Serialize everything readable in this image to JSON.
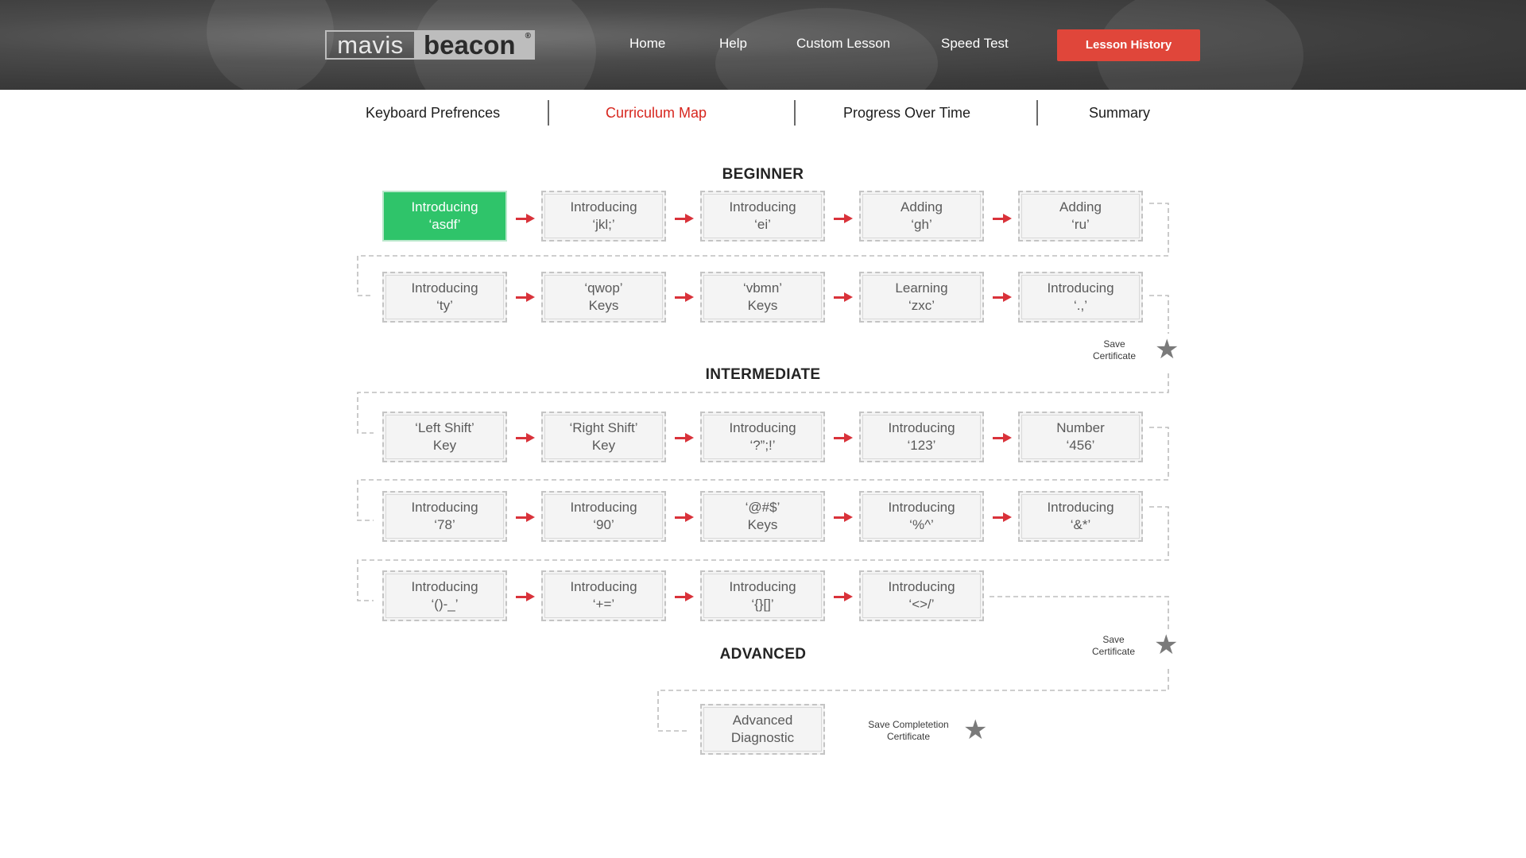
{
  "header": {
    "logo": {
      "left": "mavis",
      "right": "beacon",
      "mark": "®"
    },
    "nav": [
      "Home",
      "Help",
      "Custom Lesson",
      "Speed Test"
    ],
    "cta": "Lesson History",
    "cta_color": "#e0463a"
  },
  "tabs": [
    {
      "label": "Keyboard Prefrences",
      "active": false
    },
    {
      "label": "Curriculum Map",
      "active": true
    },
    {
      "label": "Progress Over Time",
      "active": false
    },
    {
      "label": "Summary",
      "active": false
    }
  ],
  "accent_color": "#d7261e",
  "sections": {
    "beginner": "BEGINNER",
    "intermediate": "INTERMEDIATE",
    "advanced": "ADVANCED"
  },
  "lessons": {
    "beginner_row1": [
      {
        "line1": "Introducing",
        "line2": "‘asdf’",
        "active": true
      },
      {
        "line1": "Introducing",
        "line2": "‘jkl;’"
      },
      {
        "line1": "Introducing",
        "line2": "‘ei’"
      },
      {
        "line1": "Adding",
        "line2": "‘gh’"
      },
      {
        "line1": "Adding",
        "line2": "‘ru’"
      }
    ],
    "beginner_row2": [
      {
        "line1": "Introducing",
        "line2": "‘ty’"
      },
      {
        "line1": "‘qwop’",
        "line2": "Keys"
      },
      {
        "line1": "‘vbmn’",
        "line2": "Keys"
      },
      {
        "line1": "Learning",
        "line2": "‘zxc’"
      },
      {
        "line1": "Introducing",
        "line2": "‘.,’"
      }
    ],
    "intermediate_row1": [
      {
        "line1": "‘Left Shift’",
        "line2": "Key"
      },
      {
        "line1": "‘Right Shift’",
        "line2": "Key"
      },
      {
        "line1": "Introducing",
        "line2": "‘?”;!’"
      },
      {
        "line1": "Introducing",
        "line2": "‘123’"
      },
      {
        "line1": "Number",
        "line2": "‘456’"
      }
    ],
    "intermediate_row2": [
      {
        "line1": "Introducing",
        "line2": "‘78’"
      },
      {
        "line1": "Introducing",
        "line2": "‘90’"
      },
      {
        "line1": "‘@#$’",
        "line2": "Keys"
      },
      {
        "line1": "Introducing",
        "line2": "‘%^’"
      },
      {
        "line1": "Introducing",
        "line2": "‘&*’"
      }
    ],
    "intermediate_row3": [
      {
        "line1": "Introducing",
        "line2": "‘()-_’"
      },
      {
        "line1": "Introducing",
        "line2": "‘+=’"
      },
      {
        "line1": "Introducing",
        "line2": "‘{}[]’"
      },
      {
        "line1": "Introducing",
        "line2": "‘<>/’"
      }
    ],
    "advanced_row1": [
      {
        "line1": "Advanced",
        "line2": "Diagnostic"
      }
    ]
  },
  "certificates": {
    "beginner": {
      "line1": "Save",
      "line2": "Certificate",
      "icon": "star-icon"
    },
    "intermediate": {
      "line1": "Save",
      "line2": "Certificate",
      "icon": "star-icon"
    },
    "completion": {
      "line1": "Save Completetion",
      "line2": "Certificate",
      "icon": "star-icon"
    }
  },
  "colors": {
    "active_lesson": "#2fc46a",
    "arrow": "#d9323a",
    "star": "#7a7a7a"
  }
}
